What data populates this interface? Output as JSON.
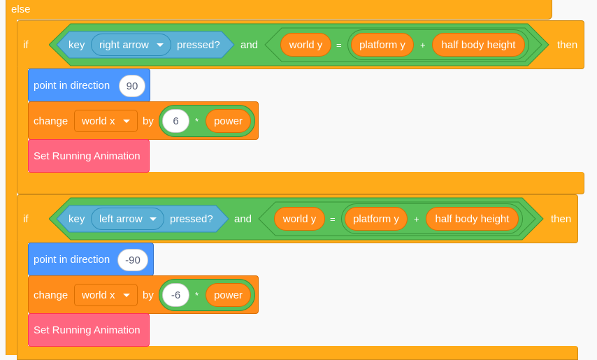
{
  "else_label": "else",
  "block1": {
    "if_label": "if",
    "then_label": "then",
    "key_label": "key",
    "key_value": "right arrow",
    "pressed_label": "pressed?",
    "and_label": "and",
    "world_y": "world y",
    "eq": "=",
    "platform_y": "platform y",
    "plus": "+",
    "half_body_height": "half body height",
    "point_label": "point in direction",
    "direction_value": "90",
    "change_label": "change",
    "change_var": "world x",
    "by_label": "by",
    "change_num": "6",
    "times": "*",
    "power": "power",
    "running_label": "Set Running Animation"
  },
  "block2": {
    "if_label": "if",
    "then_label": "then",
    "key_label": "key",
    "key_value": "left arrow",
    "pressed_label": "pressed?",
    "and_label": "and",
    "world_y": "world y",
    "eq": "=",
    "platform_y": "platform y",
    "plus": "+",
    "half_body_height": "half body height",
    "point_label": "point in direction",
    "direction_value": "-90",
    "change_label": "change",
    "change_var": "world x",
    "by_label": "by",
    "change_num": "-6",
    "times": "*",
    "power": "power",
    "running_label": "Set Running Animation"
  },
  "colors": {
    "control": "#ffab19",
    "operators": "#59c059",
    "sensing": "#5cb1d6",
    "variables": "#ff8c1a",
    "motion": "#4c97ff",
    "custom": "#ff6680"
  }
}
